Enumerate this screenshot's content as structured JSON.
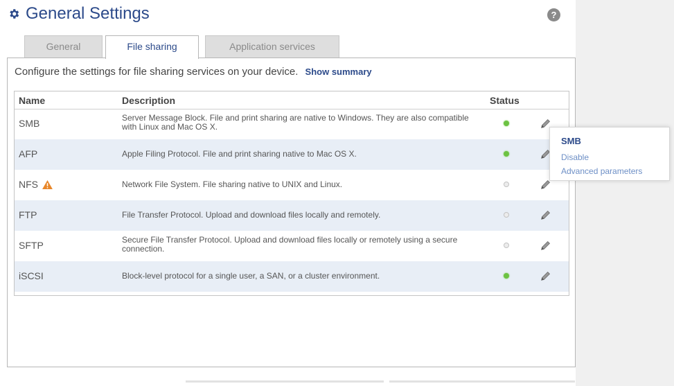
{
  "header": {
    "title": "General Settings",
    "help_label": "?"
  },
  "tabs": [
    {
      "label": "General",
      "active": false
    },
    {
      "label": "File sharing",
      "active": true
    },
    {
      "label": "Application services",
      "active": false
    }
  ],
  "intro": {
    "text": "Configure the settings for file sharing services on your device.",
    "link": "Show summary"
  },
  "table": {
    "headers": {
      "name": "Name",
      "description": "Description",
      "status": "Status"
    },
    "rows": [
      {
        "name": "SMB",
        "description": "Server Message Block. File and print sharing are native to Windows. They are also compatible with Linux and Mac OS X.",
        "status": "enabled"
      },
      {
        "name": "AFP",
        "description": "Apple Filing Protocol. File and print sharing native to Mac OS X.",
        "status": "enabled"
      },
      {
        "name": "NFS",
        "description": "Network File System. File sharing native to UNIX and Linux.",
        "status": "disabled",
        "warning": "warning-icon"
      },
      {
        "name": "FTP",
        "description": "File Transfer Protocol. Upload and download files locally and remotely.",
        "status": "disabled"
      },
      {
        "name": "SFTP",
        "description": "Secure File Transfer Protocol. Upload and download files locally or remotely using a secure connection.",
        "status": "disabled"
      },
      {
        "name": "iSCSI",
        "description": "Block-level protocol for a single user, a SAN, or a cluster environment.",
        "status": "enabled"
      }
    ]
  },
  "popup": {
    "title": "SMB",
    "items": [
      "Disable",
      "Advanced parameters"
    ]
  },
  "colors": {
    "accent": "#2c4a8a",
    "link": "#6d8fc6",
    "status_on": "#6cc242",
    "row_alt": "#e8eef6"
  }
}
